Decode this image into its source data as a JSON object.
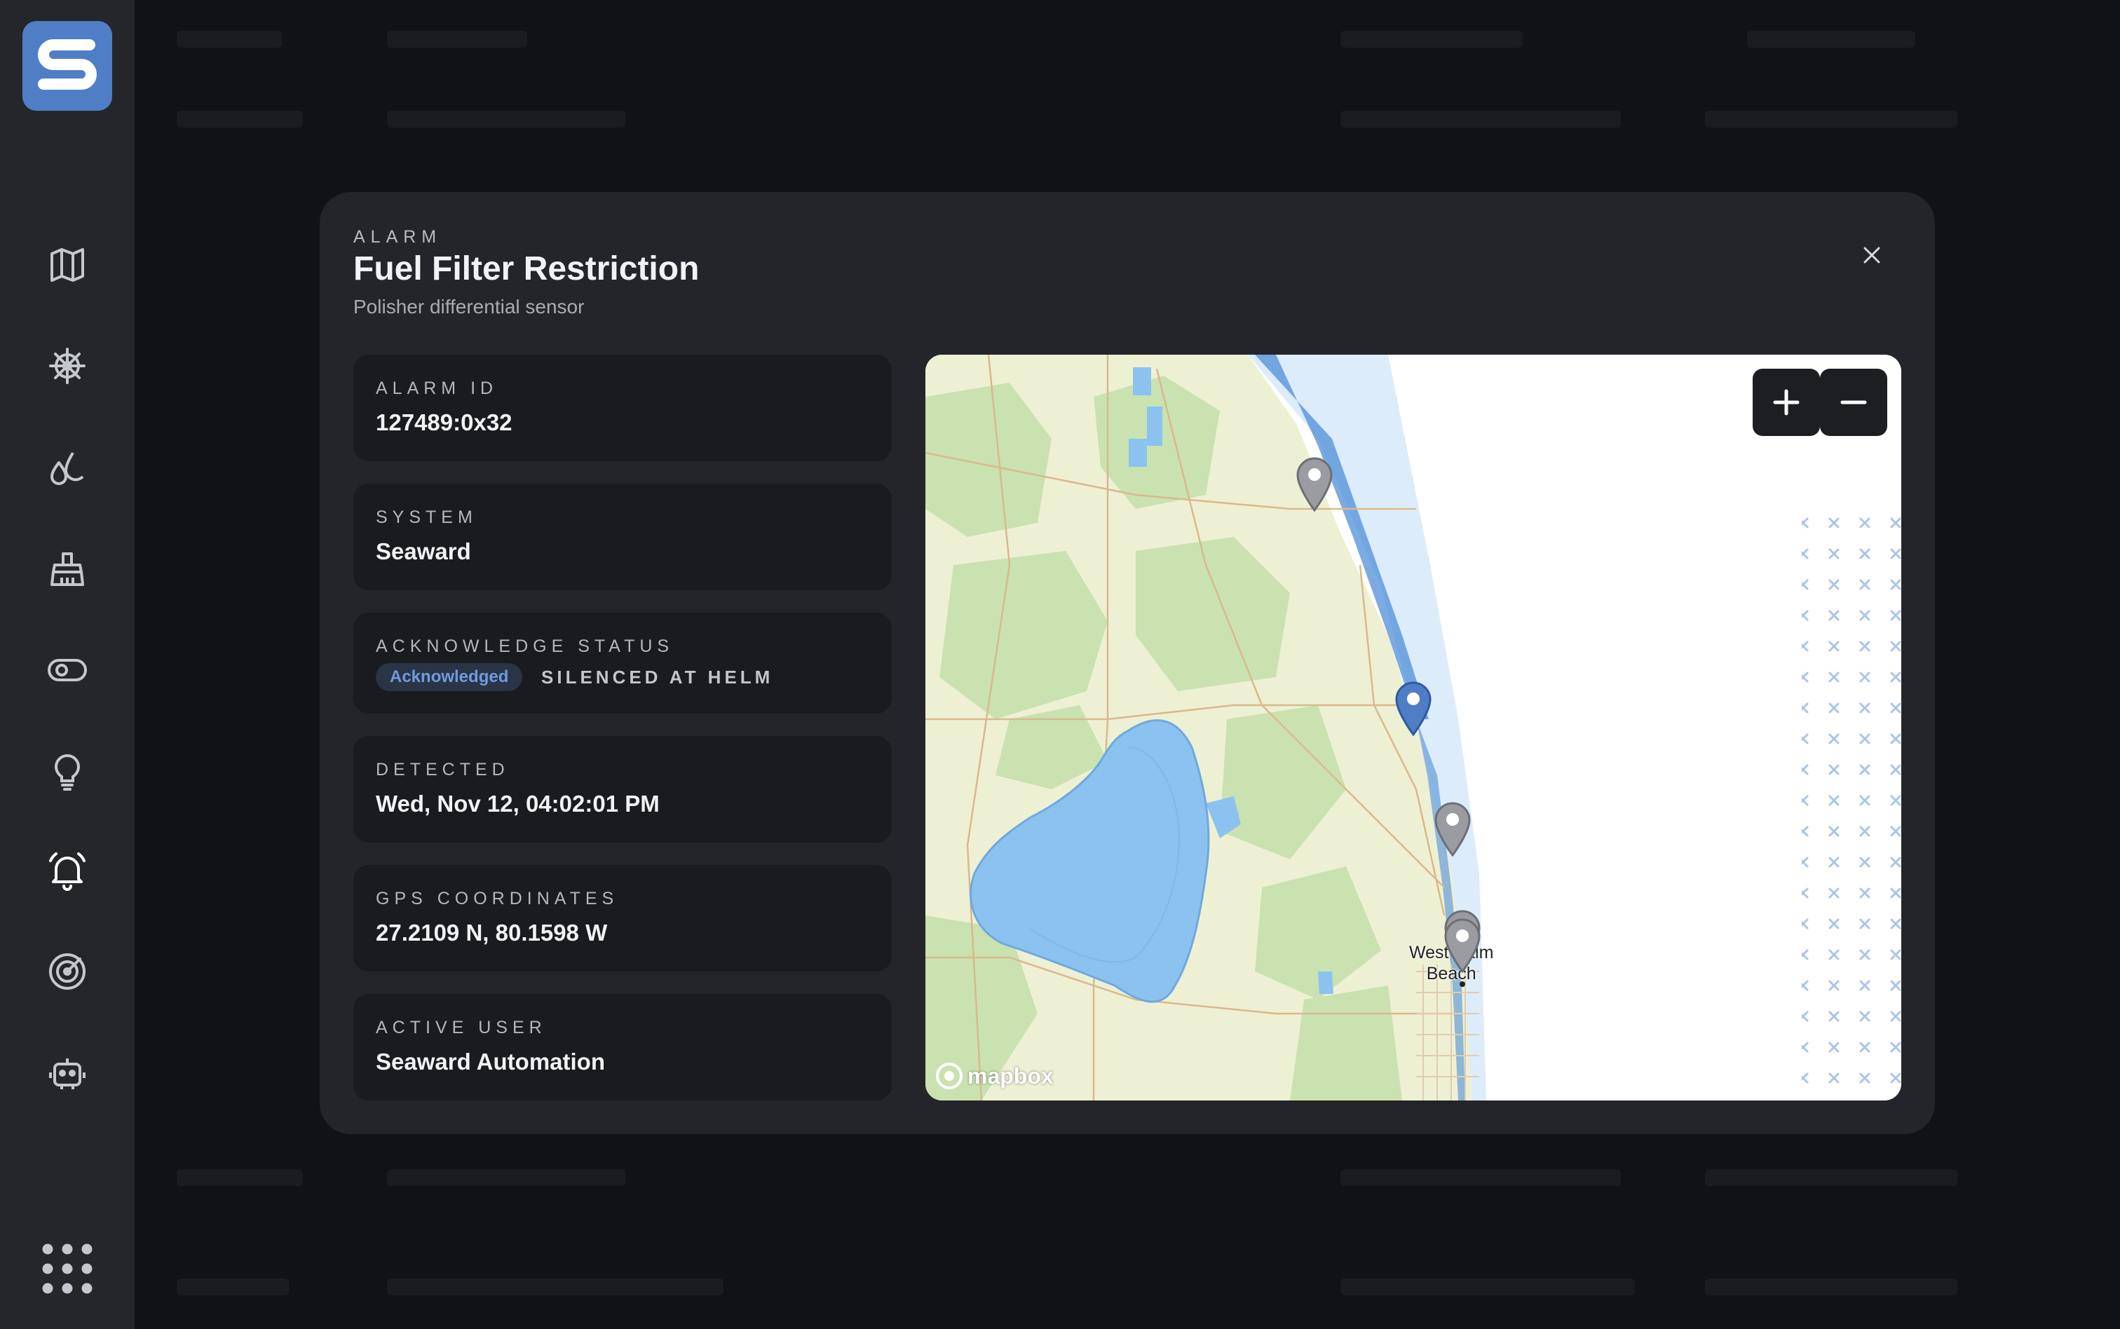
{
  "sidebar": {
    "logo": "seaward-logo",
    "items": [
      {
        "icon": "map-icon"
      },
      {
        "icon": "helm-wheel-icon"
      },
      {
        "icon": "fluids-icon"
      },
      {
        "icon": "cleaning-brush-icon"
      },
      {
        "icon": "toggle-switch-icon"
      },
      {
        "icon": "lightbulb-icon"
      },
      {
        "icon": "alarm-bell-icon",
        "active": true
      },
      {
        "icon": "radar-icon"
      },
      {
        "icon": "robot-icon"
      }
    ],
    "apps_icon": "app-grid-icon"
  },
  "modal": {
    "eyebrow": "ALARM",
    "title": "Fuel Filter Restriction",
    "subtitle": "Polisher differential sensor",
    "close_icon": "close-icon",
    "fields": {
      "alarm_id": {
        "label": "ALARM ID",
        "value": "127489:0x32"
      },
      "system": {
        "label": "SYSTEM",
        "value": "Seaward"
      },
      "ack": {
        "label": "ACKNOWLEDGE STATUS",
        "badge": "Acknowledged",
        "note": "SILENCED AT HELM"
      },
      "detected": {
        "label": "DETECTED",
        "value": "Wed, Nov 12, 04:02:01 PM"
      },
      "gps": {
        "label": "GPS COORDINATES",
        "value": "27.2109 N, 80.1598 W"
      },
      "user": {
        "label": "ACTIVE USER",
        "value": "Seaward Automation"
      }
    }
  },
  "map": {
    "city_label_1": "West Palm",
    "city_label_2": "Beach",
    "attribution": "mapbox",
    "zoom_in": "+",
    "zoom_out": "−",
    "colors": {
      "water": "#8cc2f0",
      "land": "#eef0d4",
      "green": "#c9e2b0",
      "active_pin": "#4f7ec7",
      "inactive_pin": "#9a9ca2",
      "grid_x": "#a8c4ea"
    }
  },
  "colors": {
    "accent": "#4f7ec7",
    "sidebar": "#24262a",
    "modal": "#24252a",
    "card": "#1a1b1f",
    "badge_text": "#6f9be0"
  }
}
